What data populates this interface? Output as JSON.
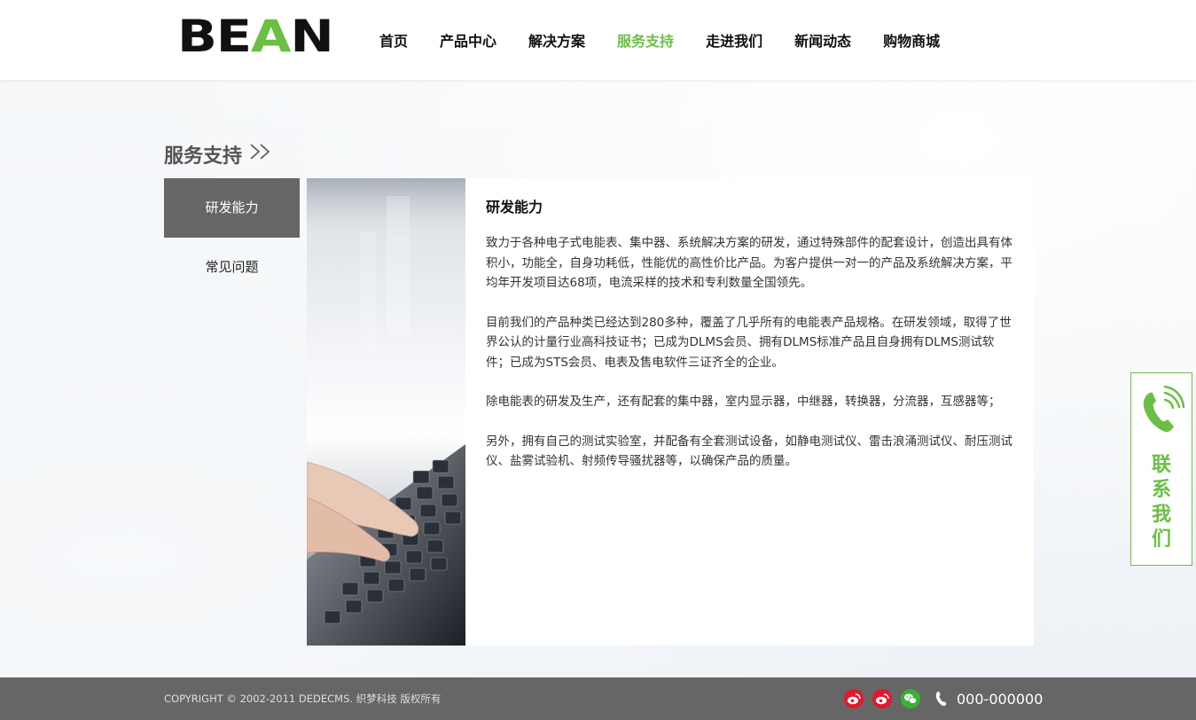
{
  "logo": {
    "part1": "BE",
    "part2": "A",
    "part3": "N"
  },
  "nav": {
    "items": [
      {
        "label": "首页"
      },
      {
        "label": "产品中心"
      },
      {
        "label": "解决方案"
      },
      {
        "label": "服务支持"
      },
      {
        "label": "走进我们"
      },
      {
        "label": "新闻动态"
      },
      {
        "label": "购物商城"
      }
    ],
    "active_index": 3
  },
  "section": {
    "title": "服务支持",
    "arrows": ">>"
  },
  "side_menu": {
    "items": [
      {
        "label": "研发能力"
      },
      {
        "label": "常见问题"
      }
    ],
    "active_index": 0
  },
  "content": {
    "title": "研发能力",
    "paragraphs": [
      " 致力于各种电子式电能表、集中器、系统解决方案的研发，通过特殊部件的配套设计，创造出具有体积小，功能全，自身功耗低，性能优的高性价比产品。为客户提供一对一的产品及系统解决方案，平均年开发项目达68项，电流采样的技术和专利数量全国领先。",
      "目前我们的产品种类已经达到280多种，覆盖了几乎所有的电能表产品规格。在研发领域，取得了世界公认的计量行业高科技证书；已成为DLMS会员、拥有DLMS标准产品且自身拥有DLMS测试软件；已成为STS会员、电表及售电软件三证齐全的企业。",
      "除电能表的研发及生产，还有配套的集中器，室内显示器，中继器，转换器，分流器，互感器等；",
      "另外，拥有自己的测试实验室，并配备有全套测试设备，如静电测试仪、雷击浪涌测试仪、耐压测试仪、盐雾试验机、射频传导骚扰器等，以确保产品的质量。"
    ]
  },
  "contact": {
    "label": "联系我们"
  },
  "footer": {
    "copyright": "COPYRIGHT © 2002-2011 DEDECMS. 织梦科技 版权所有",
    "phone": "000-000000"
  },
  "colors": {
    "accent": "#6bbf44",
    "footer_bg": "#666666",
    "weibo": "#e6162d",
    "wechat": "#3cb034"
  },
  "icons": [
    "weibo-icon",
    "tencent-weibo-icon",
    "wechat-icon",
    "phone-icon"
  ]
}
